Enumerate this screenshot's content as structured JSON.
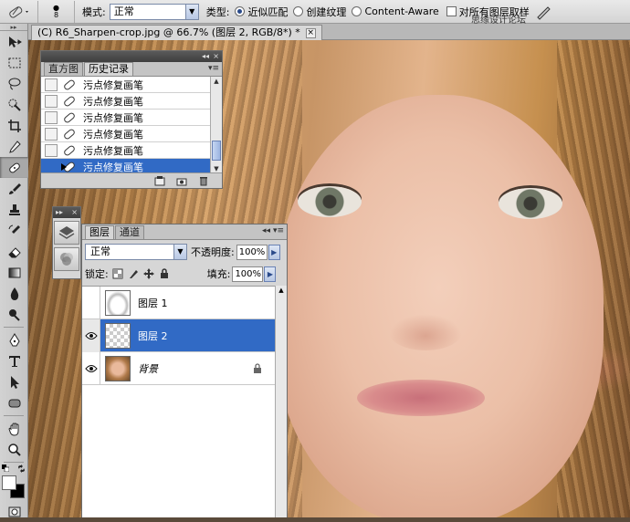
{
  "options_bar": {
    "brush_size": "8",
    "mode_label": "模式:",
    "mode_value": "正常",
    "type_label": "类型:",
    "type_options": [
      "近似匹配",
      "创建纹理",
      "Content-Aware"
    ],
    "type_selected": 0,
    "sample_all_label": "对所有图层取样",
    "watermark": "思缘设计论坛"
  },
  "document": {
    "tab_title": "(C) R6_Sharpen-crop.jpg @ 66.7% (图层 2, RGB/8*) *",
    "close_symbol": "×"
  },
  "history_panel": {
    "tabs": [
      "直方图",
      "历史记录"
    ],
    "active_tab": 1,
    "items": [
      {
        "label": "污点修复画笔"
      },
      {
        "label": "污点修复画笔"
      },
      {
        "label": "污点修复画笔"
      },
      {
        "label": "污点修复画笔"
      },
      {
        "label": "污点修复画笔"
      },
      {
        "label": "污点修复画笔"
      }
    ],
    "selected_index": 5
  },
  "layers_panel": {
    "tabs": [
      "图层",
      "通道"
    ],
    "active_tab": 0,
    "blend_mode": "正常",
    "opacity_label": "不透明度:",
    "opacity_value": "100%",
    "lock_label": "锁定:",
    "fill_label": "填充:",
    "fill_value": "100%",
    "layers": [
      {
        "name": "图层 1",
        "visible": false,
        "thumb": "mask",
        "locked": false
      },
      {
        "name": "图层 2",
        "visible": true,
        "thumb": "transparent",
        "locked": false
      },
      {
        "name": "背景",
        "visible": true,
        "thumb": "photo",
        "locked": true
      }
    ],
    "selected_index": 1
  },
  "colors": {
    "selection": "#316ac5",
    "panel_bg": "#d6d6d6",
    "toolbar_bg": "#c8c8c8"
  }
}
